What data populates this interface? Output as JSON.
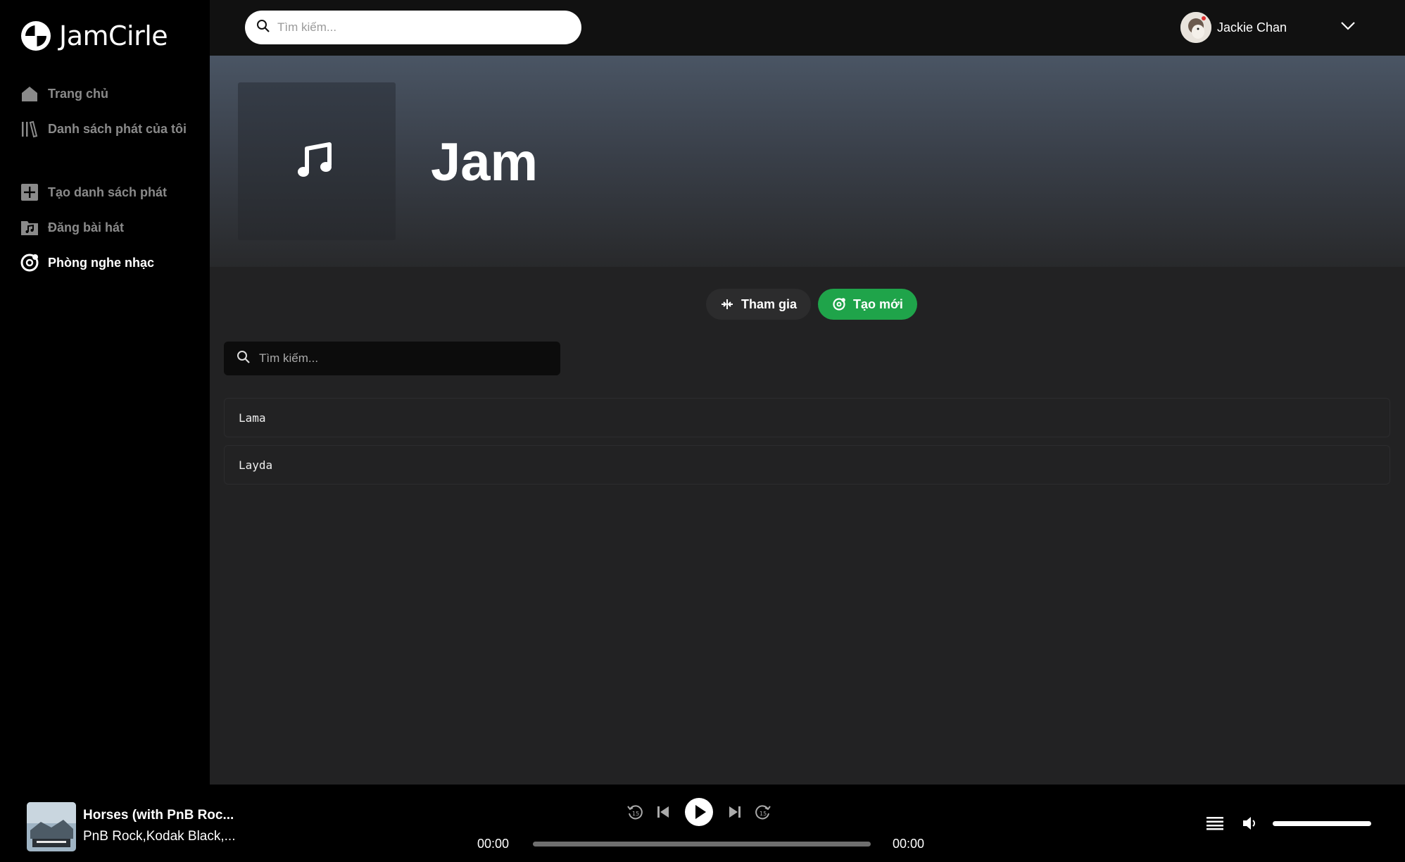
{
  "app": {
    "name": "JamCirle"
  },
  "sidebar": {
    "items": [
      {
        "label": "Trang chủ",
        "icon": "home-icon"
      },
      {
        "label": "Danh sách phát của tôi",
        "icon": "library-icon"
      },
      {
        "label": "Tạo danh sách phát",
        "icon": "plus-square-icon"
      },
      {
        "label": "Đăng bài hát",
        "icon": "music-folder-icon"
      },
      {
        "label": "Phòng nghe nhạc",
        "icon": "disc-icon",
        "active": true
      }
    ]
  },
  "topbar": {
    "search_placeholder": "Tìm kiếm...",
    "user_name": "Jackie Chan"
  },
  "hero": {
    "title": "Jam",
    "cover_icon": "music-note-icon"
  },
  "actions": {
    "join_label": "Tham gia",
    "create_label": "Tạo mới"
  },
  "room_search": {
    "placeholder": "Tìm kiếm..."
  },
  "rooms": [
    "Lama",
    "Layda"
  ],
  "player": {
    "title": "Horses (with PnB Roc...",
    "artist": "PnB Rock,Kodak Black,...",
    "current_time": "00:00",
    "duration": "00:00",
    "progress": 0,
    "volume": 1.0
  },
  "colors": {
    "accent": "#1fa44a",
    "sidebar_bg": "#000000",
    "content_bg": "#222223"
  }
}
